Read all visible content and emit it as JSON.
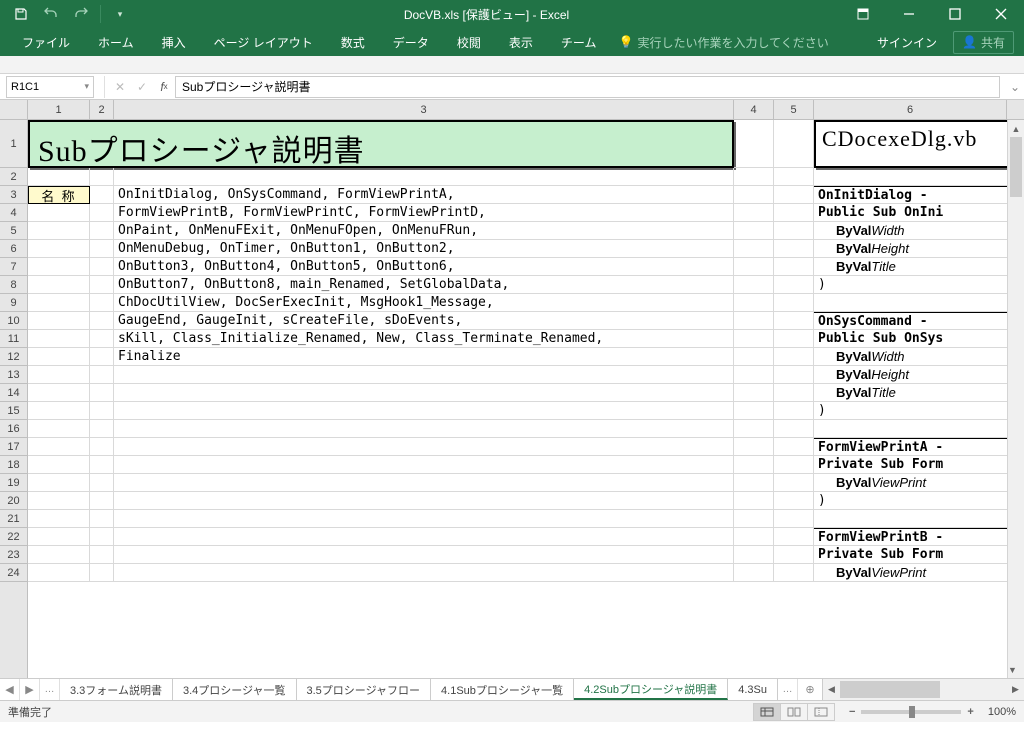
{
  "titlebar": {
    "title": "DocVB.xls [保護ビュー] - Excel"
  },
  "ribbon": {
    "tabs": [
      "ファイル",
      "ホーム",
      "挿入",
      "ページ レイアウト",
      "数式",
      "データ",
      "校閲",
      "表示",
      "チーム"
    ],
    "tellme": "実行したい作業を入力してください",
    "signin": "サインイン",
    "share": "共有"
  },
  "formulabar": {
    "namebox": "R1C1",
    "formula": "Subプロシージャ説明書"
  },
  "cols": [
    "1",
    "2",
    "3",
    "4",
    "5",
    "6"
  ],
  "banner_left": "Subプロシージャ説明書",
  "banner_right": "CDocexeDlg.vb",
  "row3_label": "名 称",
  "col3_rows": {
    "3": "OnInitDialog, OnSysCommand, FormViewPrintA,",
    "4": "FormViewPrintB, FormViewPrintC, FormViewPrintD,",
    "5": "OnPaint, OnMenuFExit, OnMenuFOpen, OnMenuFRun,",
    "6": "OnMenuDebug, OnTimer, OnButton1, OnButton2,",
    "7": "OnButton3, OnButton4, OnButton5, OnButton6,",
    "8": "OnButton7, OnButton8, main_Renamed, SetGlobalData,",
    "9": "ChDocUtilView, DocSerExecInit, MsgHook1_Message,",
    "10": "GaugeEnd, GaugeInit, sCreateFile, sDoEvents,",
    "11": "sKill, Class_Initialize_Renamed, New, Class_Terminate_Renamed,",
    "12": "Finalize"
  },
  "col6_rows": {
    "3": {
      "plain": "OnInitDialog - "
    },
    "4": {
      "plain": "Public Sub OnIni"
    },
    "5": {
      "kw": "ByVal",
      "param": "Width"
    },
    "6": {
      "kw": "ByVal",
      "param": "Height"
    },
    "7": {
      "kw": "ByVal",
      "param": "Title"
    },
    "8": {
      "plain": ")"
    },
    "10": {
      "plain": "OnSysCommand - "
    },
    "11": {
      "plain": "Public Sub OnSys"
    },
    "12": {
      "kw": "ByVal",
      "param": "Width"
    },
    "13": {
      "kw": "ByVal",
      "param": "Height"
    },
    "14": {
      "kw": "ByVal",
      "param": "Title"
    },
    "15": {
      "plain": ")"
    },
    "17": {
      "plain": "FormViewPrintA -"
    },
    "18": {
      "plain": "Private Sub Form"
    },
    "19": {
      "kw": "ByVal",
      "param": "ViewPrint"
    },
    "20": {
      "plain": ")"
    },
    "22": {
      "plain": "FormViewPrintB -"
    },
    "23": {
      "plain": "Private Sub Form"
    },
    "24": {
      "kw": "ByVal",
      "param": "ViewPrint"
    }
  },
  "sheettabs": [
    "3.3フォーム説明書",
    "3.4プロシージャ一覧",
    "3.5プロシージャフロー",
    "4.1Subプロシージャ一覧",
    "4.2Subプロシージャ説明書",
    "4.3Su"
  ],
  "active_tab_index": 4,
  "statusbar": {
    "ready": "準備完了",
    "zoom": "100%"
  }
}
